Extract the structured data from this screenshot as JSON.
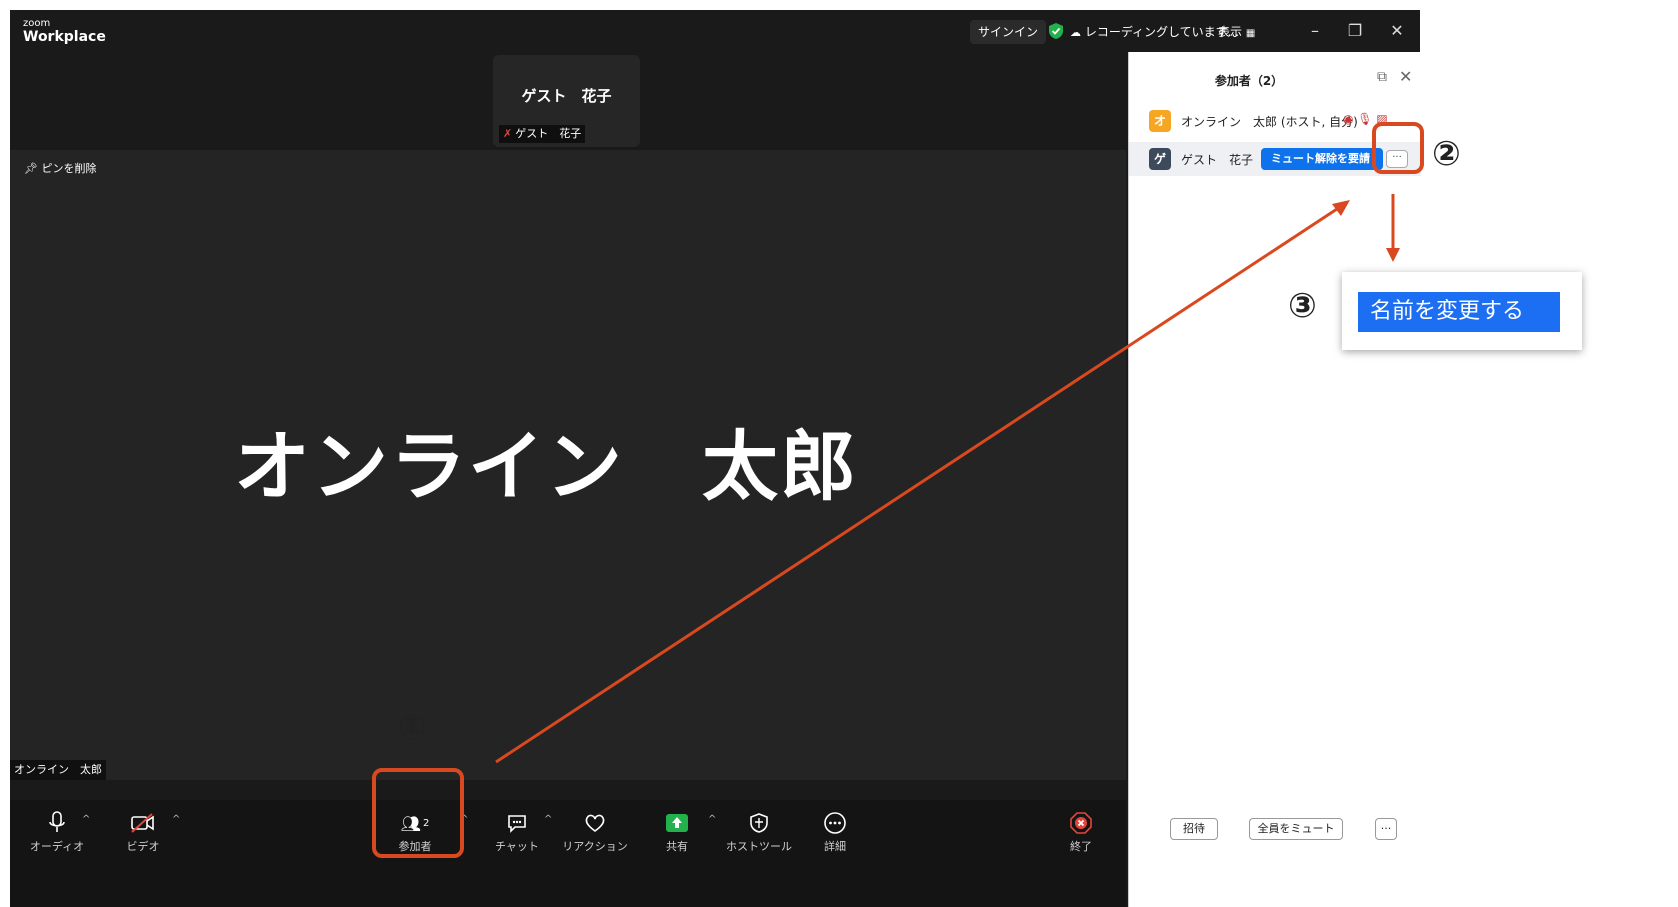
{
  "titlebar": {
    "logo_small": "zoom",
    "logo_big": "Workplace",
    "signin": "サインイン",
    "recording": "レコーディングしています...",
    "view": "表示"
  },
  "guest_tile": {
    "name": "ゲスト　花子",
    "label": "ゲスト　花子"
  },
  "main_video": {
    "pin_label": "ピンを削除",
    "name": "オンライン　太郎",
    "self_label": "オンライン　太郎"
  },
  "toolbar": {
    "audio": "オーディオ",
    "video": "ビデオ",
    "participants": "参加者",
    "participants_count": "2",
    "chat": "チャット",
    "reactions": "リアクション",
    "share": "共有",
    "host_tools": "ホストツール",
    "more": "詳細",
    "end": "終了"
  },
  "panel": {
    "title": "参加者（2）",
    "participants": [
      {
        "avatar": "オ",
        "name": "オンライン　太郎 (ホスト, 自分)",
        "avatar_color": "#f5a623"
      },
      {
        "avatar": "ゲ",
        "name": "ゲスト　花子",
        "avatar_color": "#3d4a5c",
        "button": "ミュート解除を要請"
      }
    ],
    "more_label": "···",
    "invite": "招待",
    "mute_all": "全員をミュート",
    "footer_more": "···"
  },
  "annotations": {
    "step1": "①",
    "step2": "②",
    "step3": "③",
    "menu_item": "名前を変更する",
    "color": "#d9491f"
  }
}
